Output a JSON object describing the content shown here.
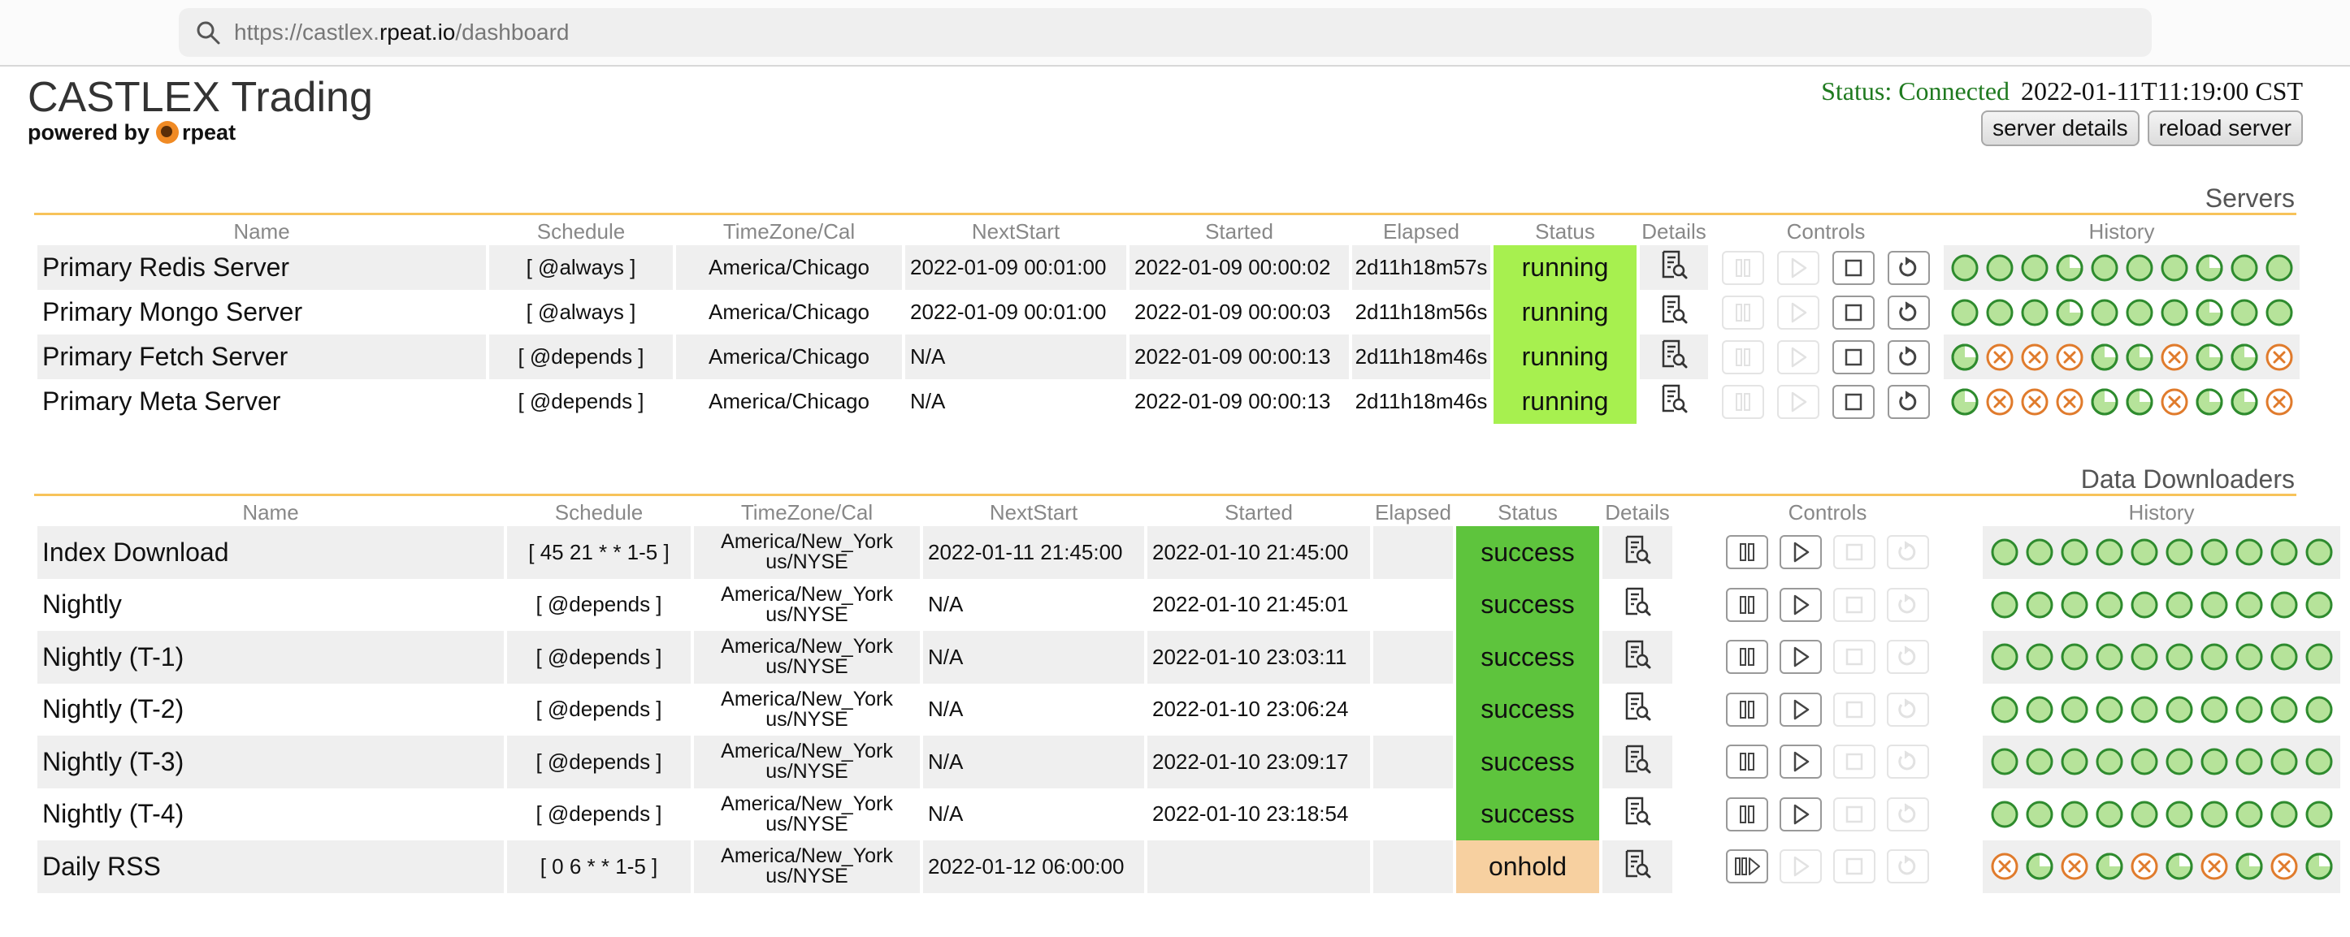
{
  "browser": {
    "url_prefix": "https://castlex.",
    "url_domain": "rpeat.io",
    "url_path": "/dashboard"
  },
  "header": {
    "title": "CASTLEX Trading",
    "powered_by": "powered by",
    "brand": "rpeat",
    "status": "Status: Connected",
    "timestamp": "2022-01-11T11:19:00 CST",
    "server_details_label": "server details",
    "reload_server_label": "reload server"
  },
  "colors": {
    "running": "#a7f04f",
    "success": "#5ec43d",
    "onhold": "#f7d0a0",
    "accent_rule": "#f7c35a",
    "history_ok": "#2e8b2e",
    "history_fail": "#e07b2c"
  },
  "servers": {
    "title": "Servers",
    "columns": [
      "Name",
      "Schedule",
      "TimeZone/Cal",
      "NextStart",
      "Started",
      "Elapsed",
      "Status",
      "Details",
      "Controls",
      "History"
    ],
    "rows": [
      {
        "name": "Primary Redis Server",
        "schedule": "[ @always ]",
        "tz": "America/Chicago",
        "next": "2022-01-09 00:01:00",
        "started": "2022-01-09 00:00:02",
        "elapsed": "2d11h18m57s",
        "status": "running",
        "history": [
          "ok",
          "ok",
          "ok",
          "partial",
          "ok",
          "ok",
          "ok",
          "partial",
          "ok",
          "ok"
        ]
      },
      {
        "name": "Primary Mongo Server",
        "schedule": "[ @always ]",
        "tz": "America/Chicago",
        "next": "2022-01-09 00:01:00",
        "started": "2022-01-09 00:00:03",
        "elapsed": "2d11h18m56s",
        "status": "running",
        "history": [
          "ok",
          "ok",
          "ok",
          "partial",
          "ok",
          "ok",
          "ok",
          "partial",
          "ok",
          "ok"
        ]
      },
      {
        "name": "Primary Fetch Server",
        "schedule": "[ @depends ]",
        "tz": "America/Chicago",
        "next": "N/A",
        "started": "2022-01-09 00:00:13",
        "elapsed": "2d11h18m46s",
        "status": "running",
        "history": [
          "partial",
          "fail",
          "fail",
          "fail",
          "partial",
          "partial",
          "fail",
          "partial",
          "partial",
          "fail"
        ]
      },
      {
        "name": "Primary Meta Server",
        "schedule": "[ @depends ]",
        "tz": "America/Chicago",
        "next": "N/A",
        "started": "2022-01-09 00:00:13",
        "elapsed": "2d11h18m46s",
        "status": "running",
        "history": [
          "partial",
          "fail",
          "fail",
          "fail",
          "partial",
          "partial",
          "fail",
          "partial",
          "partial",
          "fail"
        ]
      }
    ]
  },
  "downloaders": {
    "title": "Data Downloaders",
    "columns": [
      "Name",
      "Schedule",
      "TimeZone/Cal",
      "NextStart",
      "Started",
      "Elapsed",
      "Status",
      "Details",
      "Controls",
      "History"
    ],
    "rows": [
      {
        "name": "Index Download",
        "schedule": "[ 45 21 * * 1-5 ]",
        "tz1": "America/New_York",
        "tz2": "us/NYSE",
        "next": "2022-01-11 21:45:00",
        "started": "2022-01-10 21:45:00",
        "elapsed": "",
        "status": "success",
        "history": [
          "ok",
          "ok",
          "ok",
          "ok",
          "ok",
          "ok",
          "ok",
          "ok",
          "ok",
          "ok"
        ]
      },
      {
        "name": "Nightly",
        "schedule": "[ @depends ]",
        "tz1": "America/New_York",
        "tz2": "us/NYSE",
        "next": "N/A",
        "started": "2022-01-10 21:45:01",
        "elapsed": "",
        "status": "success",
        "history": [
          "ok",
          "ok",
          "ok",
          "ok",
          "ok",
          "ok",
          "ok",
          "ok",
          "ok",
          "ok"
        ]
      },
      {
        "name": "Nightly (T-1)",
        "schedule": "[ @depends ]",
        "tz1": "America/New_York",
        "tz2": "us/NYSE",
        "next": "N/A",
        "started": "2022-01-10 23:03:11",
        "elapsed": "",
        "status": "success",
        "history": [
          "ok",
          "ok",
          "ok",
          "ok",
          "ok",
          "ok",
          "ok",
          "ok",
          "ok",
          "ok"
        ]
      },
      {
        "name": "Nightly (T-2)",
        "schedule": "[ @depends ]",
        "tz1": "America/New_York",
        "tz2": "us/NYSE",
        "next": "N/A",
        "started": "2022-01-10 23:06:24",
        "elapsed": "",
        "status": "success",
        "history": [
          "ok",
          "ok",
          "ok",
          "ok",
          "ok",
          "ok",
          "ok",
          "ok",
          "ok",
          "ok"
        ]
      },
      {
        "name": "Nightly (T-3)",
        "schedule": "[ @depends ]",
        "tz1": "America/New_York",
        "tz2": "us/NYSE",
        "next": "N/A",
        "started": "2022-01-10 23:09:17",
        "elapsed": "",
        "status": "success",
        "history": [
          "ok",
          "ok",
          "ok",
          "ok",
          "ok",
          "ok",
          "ok",
          "ok",
          "ok",
          "ok"
        ]
      },
      {
        "name": "Nightly (T-4)",
        "schedule": "[ @depends ]",
        "tz1": "America/New_York",
        "tz2": "us/NYSE",
        "next": "N/A",
        "started": "2022-01-10 23:18:54",
        "elapsed": "",
        "status": "success",
        "history": [
          "ok",
          "ok",
          "ok",
          "ok",
          "ok",
          "ok",
          "ok",
          "ok",
          "ok",
          "ok"
        ]
      },
      {
        "name": "Daily RSS",
        "schedule": "[ 0 6 * * 1-5 ]",
        "tz1": "America/New_York",
        "tz2": "us/NYSE",
        "next": "2022-01-12 06:00:00",
        "started": "",
        "elapsed": "",
        "status": "onhold",
        "history": [
          "fail",
          "partial",
          "fail",
          "partial",
          "fail",
          "partial",
          "fail",
          "partial",
          "fail",
          "partial"
        ]
      }
    ]
  }
}
